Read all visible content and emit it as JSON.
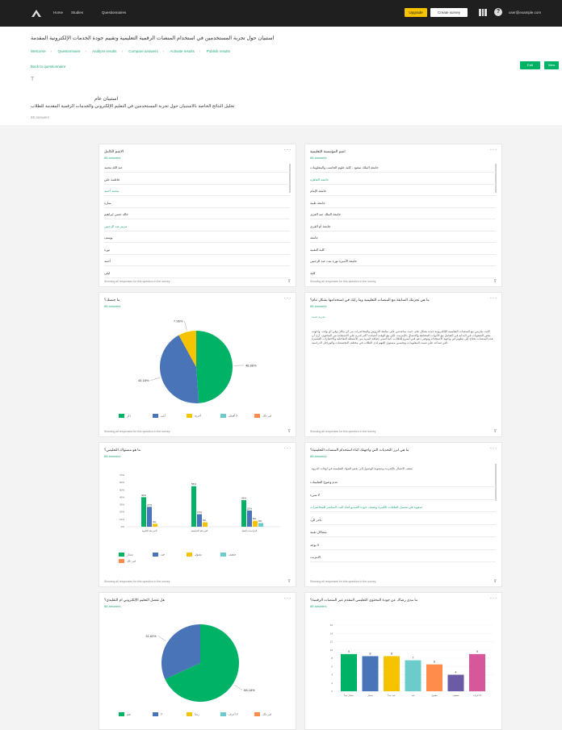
{
  "topbar": {
    "nav": [
      "Home",
      "Studies",
      "Questionnaires"
    ],
    "upgrade_label": "Upgrade",
    "create_label": "Create survey",
    "help_label": "?",
    "user_email": "user@example.com"
  },
  "header": {
    "title": "استبيان حول تجربة المستخدمين في استخدام المنصات الرقمية التعليمية وتقييم جودة الخدمات الإلكترونية المقدمة",
    "steps": [
      "Welcome",
      "Questionnaire",
      "Analyze results",
      "Compare answers",
      "Activate results",
      "Publish results"
    ],
    "back_label": "Back to questionnaire",
    "btn_primary": "Edit",
    "btn_secondary": "View",
    "t_icon": "T",
    "survey_name": "استبيان عام",
    "survey_description": "تحليل النتائج الخاصة بالاستبيان حول تجربة المستخدمين في التعليم الإلكتروني والخدمات الرقمية المقدمة للطلاب",
    "survey_meta": "88 answers"
  },
  "cards": [
    {
      "title": "الاسم الكامل",
      "subtitle": "88 answers",
      "rows": [
        {
          "text": "عبد الله محمد",
          "link": false
        },
        {
          "text": "فاطمة علي",
          "link": false
        },
        {
          "text": "محمد أحمد",
          "link": true
        },
        {
          "text": "سارة",
          "link": false
        },
        {
          "text": "خالد حسن إبراهيم",
          "link": false
        },
        {
          "text": "مريم عبد الرحمن",
          "link": true
        },
        {
          "text": "يوسف",
          "link": false
        },
        {
          "text": "نورة",
          "link": false
        },
        {
          "text": "أحمد",
          "link": false
        },
        {
          "text": "ليلى",
          "link": false
        }
      ],
      "footer": "Showing all responses for this question in the survey"
    },
    {
      "title": "اسم المؤسسة التعليمية",
      "subtitle": "88 answers",
      "rows": [
        {
          "text": "جامعة الملك سعود - كلية علوم الحاسب والمعلومات",
          "link": false
        },
        {
          "text": "جامعة القاهرة",
          "link": true
        },
        {
          "text": "جامعة الإمام",
          "link": false
        },
        {
          "text": "جامعة طيبة",
          "link": false
        },
        {
          "text": "جامعة الملك عبد العزيز",
          "link": false
        },
        {
          "text": "جامعة أم القرى",
          "link": false
        },
        {
          "text": "جامعة",
          "link": false
        },
        {
          "text": "كلية التقنية",
          "link": false
        },
        {
          "text": "جامعة الأميرة نورة بنت عبد الرحمن",
          "link": false
        },
        {
          "text": "كلية",
          "link": false
        }
      ],
      "footer": "Showing all responses for this question in the survey"
    },
    {
      "title": "ما جنسك؟",
      "subtitle": "88 answers",
      "slices_pct": [
        48.86,
        43.18,
        7.96,
        0,
        0
      ],
      "slice_labels": [
        "48.86%",
        "43.18%",
        "7.96%"
      ],
      "legend": [
        "ذكر",
        "أنثى",
        "أخرى",
        "لا أفضل",
        "غير ذلك"
      ],
      "footer": "Showing all responses for this question in the survey"
    },
    {
      "title": "ما هي تجربتك السابقة مع المنصات التعليمية وما رأيك في استخدامها بشكل عام؟",
      "subtitle": "88 answers",
      "excerpt": "تجربة جيدة",
      "paragraph": "كانت تجربتي مع المنصات التعليمية الإلكترونية جيدة بشكل عام، حيث ساعدتني على متابعة الدروس والمحاضرات من أي مكان وفي أي وقت. واجهت بعض الصعوبات في البداية في التعامل مع الأدوات المختلفة والاتصال بالإنترنت، لكن مع الوقت أصبحت أكثر قدرة على الاستفادة من المحتوى. أرى أن هذه المنصات تحتاج إلى تطوير في واجهة الاستخدام وتوفير دعم فني أسرع للطلاب، كما أتمنى إضافة المزيد من الأنشطة التفاعلية والاختبارات القصيرة التي تساعد على تثبيت المعلومات وتحسين مستوى الفهم لدى الطلاب في مختلف التخصصات والمراحل الدراسية.",
      "footer": "Showing all responses for this question in the survey"
    },
    {
      "title": "ما هو مستواك التعليمي؟",
      "subtitle": "88 answers",
      "footer": "Showing all responses for this question in the survey"
    },
    {
      "title": "ما هي أبرز التحديات التي واجهتك أثناء استخدام المنصات التعليمية؟",
      "subtitle": "88 answers",
      "lead": "ضعف الاتصال بالإنترنت وصعوبة الوصول إلى بعض المواد التعليمية في أوقات الذروة",
      "rows": [
        {
          "text": "عدم وضوح التعليمات",
          "link": false
        },
        {
          "text": "لا شيء",
          "link": false
        },
        {
          "text": "صعوبة في تحميل الملفات الكبيرة وضعف جودة الفيديو أثناء البث المباشر للمحاضرات",
          "link": true
        },
        {
          "text": "تأخر الرد",
          "link": false
        },
        {
          "text": "مشاكل تقنية",
          "link": false
        },
        {
          "text": "لا يوجد",
          "link": false
        },
        {
          "text": "الانترنت",
          "link": false
        }
      ],
      "footer": "Showing all responses for this question in the survey"
    },
    {
      "title": "هل تفضل التعليم الإلكتروني أم التقليدي؟",
      "subtitle": "88 answers",
      "slices_pct": [
        68.18,
        31.82,
        0,
        0,
        0
      ],
      "slice_labels": [
        "68.18%",
        "31.82%"
      ],
      "legend": [
        "نعم",
        "لا",
        "ربما",
        "لا أعرف",
        "غير ذلك"
      ],
      "footer": "Showing all responses for this question in the survey"
    },
    {
      "title": "ما مدى رضاك عن جودة المحتوى التعليمي المقدم عبر المنصات الرقمية؟",
      "subtitle": "88 answers",
      "footer": "Showing all responses for this question in the survey"
    }
  ],
  "icons": {
    "logo": "logo-icon",
    "apps": "apps-grid-icon",
    "help": "help-icon",
    "more": "more-icon",
    "filter": "filter-icon"
  },
  "colors": {
    "green": "#00b266",
    "blue": "#4a74b8",
    "yellow": "#f6c300",
    "teal": "#6ccccc",
    "orange": "#ff8c4a",
    "purple": "#6b5aa6",
    "pink": "#d6589a"
  },
  "chart_data": [
    {
      "type": "pie",
      "title": "ما جنسك؟",
      "categories": [
        "ذكر",
        "أنثى",
        "أخرى",
        "لا أفضل",
        "غير ذلك"
      ],
      "values": [
        48.86,
        43.18,
        7.96,
        0,
        0
      ]
    },
    {
      "type": "bar",
      "title": "ما هو مستواك التعليمي؟",
      "categories": [
        "ثانوي",
        "جامعي",
        "دراسات عليا"
      ],
      "series": [
        {
          "name": "ممتاز",
          "values": [
            40,
            55,
            36
          ]
        },
        {
          "name": "جيد",
          "values": [
            27,
            17,
            22
          ]
        },
        {
          "name": "مقبول",
          "values": [
            4,
            6,
            8
          ]
        },
        {
          "name": "ضعيف",
          "values": [
            0,
            0,
            5
          ]
        },
        {
          "name": "غير ذلك",
          "values": [
            0,
            0,
            0
          ]
        }
      ],
      "data_labels": [
        [
          "40%",
          "27%",
          "4%"
        ],
        [
          "55%",
          "17%",
          "6%"
        ],
        [
          "36%",
          "22%",
          "8%",
          "5%"
        ]
      ],
      "yticks": [
        "0%",
        "10%",
        "20%",
        "30%",
        "40%",
        "50%",
        "60%",
        "70%"
      ],
      "xlabels": [
        "المرحلة الثانوية",
        "المرحلة الجامعية",
        "الدراسات العليا"
      ],
      "ylim": [
        0,
        70
      ]
    },
    {
      "type": "pie",
      "title": "هل تفضل التعليم الإلكتروني أم التقليدي؟",
      "categories": [
        "نعم",
        "لا",
        "ربما",
        "لا أعرف",
        "غير ذلك"
      ],
      "values": [
        68.18,
        31.82,
        0,
        0,
        0
      ]
    },
    {
      "type": "bar",
      "title": "ما مدى رضاك عن جودة المحتوى التعليمي المقدم عبر المنصات الرقمية؟",
      "categories": [
        "1",
        "2",
        "3",
        "4",
        "5",
        "6",
        "7"
      ],
      "values": [
        9,
        8.5,
        8.5,
        7.5,
        6.5,
        4,
        9
      ],
      "data_labels": [
        "9",
        "8",
        "8",
        "7",
        "6",
        "4",
        "9"
      ],
      "yticks": [
        "0",
        "2",
        "4",
        "6",
        "8",
        "10",
        "12",
        "14",
        "16"
      ],
      "xlabels": [
        "ممتاز جداً",
        "ممتاز",
        "جيد جداً",
        "جيد",
        "مقبول",
        "ضعيف",
        "لا أعرف"
      ],
      "ylim": [
        0,
        16
      ]
    }
  ]
}
